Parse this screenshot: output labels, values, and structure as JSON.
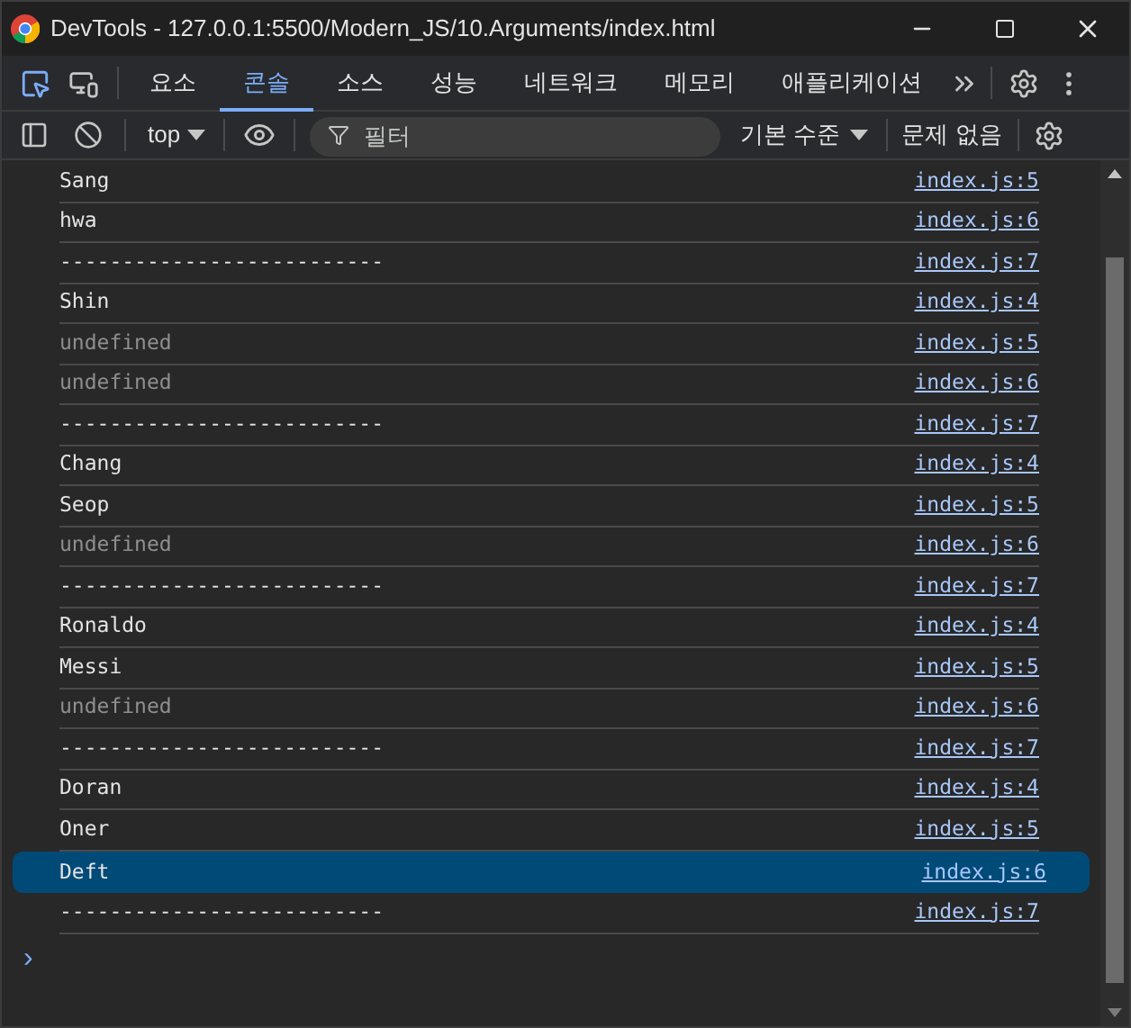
{
  "window": {
    "title": "DevTools - 127.0.0.1:5500/Modern_JS/10.Arguments/index.html"
  },
  "tabs": [
    {
      "label": "요소",
      "selected": false
    },
    {
      "label": "콘솔",
      "selected": true
    },
    {
      "label": "소스",
      "selected": false
    },
    {
      "label": "성능",
      "selected": false
    },
    {
      "label": "네트워크",
      "selected": false
    },
    {
      "label": "메모리",
      "selected": false
    },
    {
      "label": "애플리케이션",
      "selected": false
    }
  ],
  "toolbar": {
    "context": "top",
    "filter": {
      "placeholder": "필터"
    },
    "levels": "기본 수준",
    "issues": "문제 없음"
  },
  "console": {
    "rows": [
      {
        "kind": "log",
        "text": "Sang",
        "source": "index.js:5",
        "selected": false
      },
      {
        "kind": "log",
        "text": "hwa",
        "source": "index.js:6",
        "selected": false
      },
      {
        "kind": "log",
        "text": "--------------------------",
        "source": "index.js:7",
        "selected": false
      },
      {
        "kind": "log",
        "text": "Shin",
        "source": "index.js:4",
        "selected": false
      },
      {
        "kind": "undefined",
        "text": "undefined",
        "source": "index.js:5",
        "selected": false
      },
      {
        "kind": "undefined",
        "text": "undefined",
        "source": "index.js:6",
        "selected": false
      },
      {
        "kind": "log",
        "text": "--------------------------",
        "source": "index.js:7",
        "selected": false
      },
      {
        "kind": "log",
        "text": "Chang",
        "source": "index.js:4",
        "selected": false
      },
      {
        "kind": "log",
        "text": "Seop",
        "source": "index.js:5",
        "selected": false
      },
      {
        "kind": "undefined",
        "text": "undefined",
        "source": "index.js:6",
        "selected": false
      },
      {
        "kind": "log",
        "text": "--------------------------",
        "source": "index.js:7",
        "selected": false
      },
      {
        "kind": "log",
        "text": "Ronaldo",
        "source": "index.js:4",
        "selected": false
      },
      {
        "kind": "log",
        "text": "Messi",
        "source": "index.js:5",
        "selected": false
      },
      {
        "kind": "undefined",
        "text": "undefined",
        "source": "index.js:6",
        "selected": false
      },
      {
        "kind": "log",
        "text": "--------------------------",
        "source": "index.js:7",
        "selected": false
      },
      {
        "kind": "log",
        "text": "Doran",
        "source": "index.js:4",
        "selected": false
      },
      {
        "kind": "log",
        "text": "Oner",
        "source": "index.js:5",
        "selected": false
      },
      {
        "kind": "log",
        "text": "Deft",
        "source": "index.js:6",
        "selected": true
      },
      {
        "kind": "log",
        "text": "--------------------------",
        "source": "index.js:7",
        "selected": false
      }
    ],
    "prompt": "›"
  }
}
